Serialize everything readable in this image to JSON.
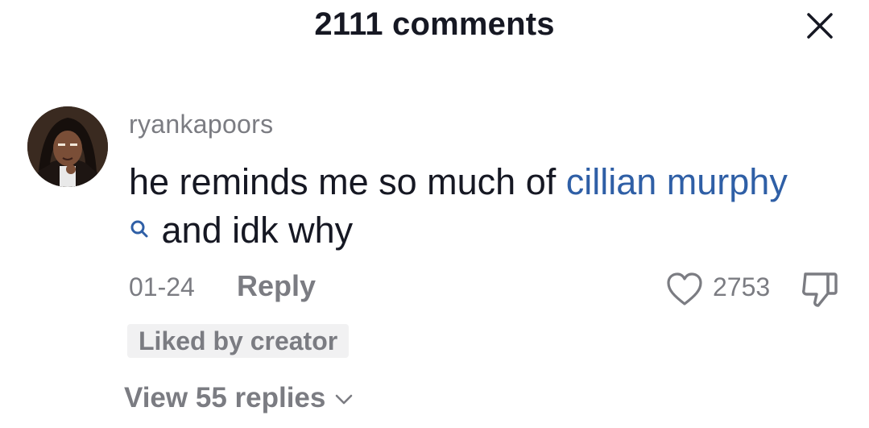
{
  "header": {
    "title": "2111 comments",
    "close_icon": "close-icon"
  },
  "comment": {
    "username": "ryankapoors",
    "text_before_link": "he reminds me so much of ",
    "link_text": "cillian murphy",
    "text_after_link": "and idk why",
    "date": "01-24",
    "reply_label": "Reply",
    "like_count": "2753",
    "badge": "Liked by creator",
    "view_replies_label": "View 55 replies"
  },
  "colors": {
    "text_primary": "#161823",
    "text_secondary": "#7b7c82",
    "link": "#2f5fa6",
    "badge_bg": "#f1f1f2"
  },
  "icons": [
    "close-icon",
    "search-icon",
    "heart-icon",
    "dislike-icon",
    "chevron-down-icon"
  ]
}
